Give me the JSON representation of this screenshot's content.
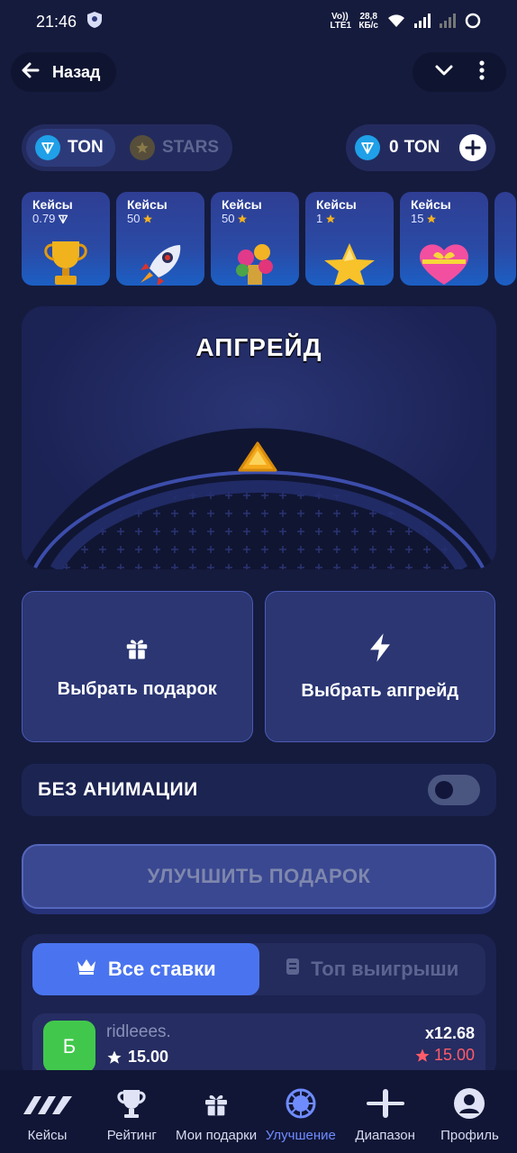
{
  "status_bar": {
    "time": "21:46",
    "net_label": "Vo)) LTE1",
    "speed_value": "28,8",
    "speed_unit": "КБ/с"
  },
  "header": {
    "back_label": "Назад"
  },
  "currency": {
    "ton_label": "TON",
    "stars_label": "STARS",
    "selected": "TON",
    "balance_amount": "0",
    "balance_currency": "TON"
  },
  "cases": [
    {
      "label": "Кейсы",
      "price": "0.79",
      "currency_icon": "ton-icon",
      "art": "trophy"
    },
    {
      "label": "Кейсы",
      "price": "50",
      "currency_icon": "star-icon",
      "art": "rocket"
    },
    {
      "label": "Кейсы",
      "price": "50",
      "currency_icon": "star-icon",
      "art": "flowers"
    },
    {
      "label": "Кейсы",
      "price": "1",
      "currency_icon": "star-icon",
      "art": "star"
    },
    {
      "label": "Кейсы",
      "price": "15",
      "currency_icon": "star-icon",
      "art": "heart"
    }
  ],
  "upgrade": {
    "title": "АПГРЕЙД"
  },
  "choices": {
    "gift_label": "Выбрать подарок",
    "upgrade_label": "Выбрать апгрейд"
  },
  "animation_toggle": {
    "label": "БЕЗ АНИМАЦИИ",
    "enabled": false
  },
  "upgrade_button": {
    "label": "УЛУЧШИТЬ ПОДАРОК"
  },
  "bets": {
    "tabs": [
      {
        "label": "Все ставки",
        "active": true
      },
      {
        "label": "Топ выигрыши",
        "active": false
      }
    ],
    "rows": [
      {
        "avatar_letter": "Б",
        "user": "ridleees.",
        "amount": "15.00",
        "multiplier": "x12.68",
        "win": "15.00"
      }
    ]
  },
  "bottom_nav": [
    {
      "label": "Кейсы",
      "icon": "cases-icon",
      "active": false
    },
    {
      "label": "Рейтинг",
      "icon": "trophy-icon",
      "active": false
    },
    {
      "label": "Мои подарки",
      "icon": "gift-icon",
      "active": false
    },
    {
      "label": "Улучшение",
      "icon": "upgrade-icon",
      "active": true
    },
    {
      "label": "Диапазон",
      "icon": "range-icon",
      "active": false
    },
    {
      "label": "Профиль",
      "icon": "profile-icon",
      "active": false
    }
  ],
  "colors": {
    "background": "#151b3d",
    "accent": "#4a74ef",
    "ton": "#1fa0e8",
    "star": "#f5b21f",
    "win": "#ff5c6a"
  }
}
